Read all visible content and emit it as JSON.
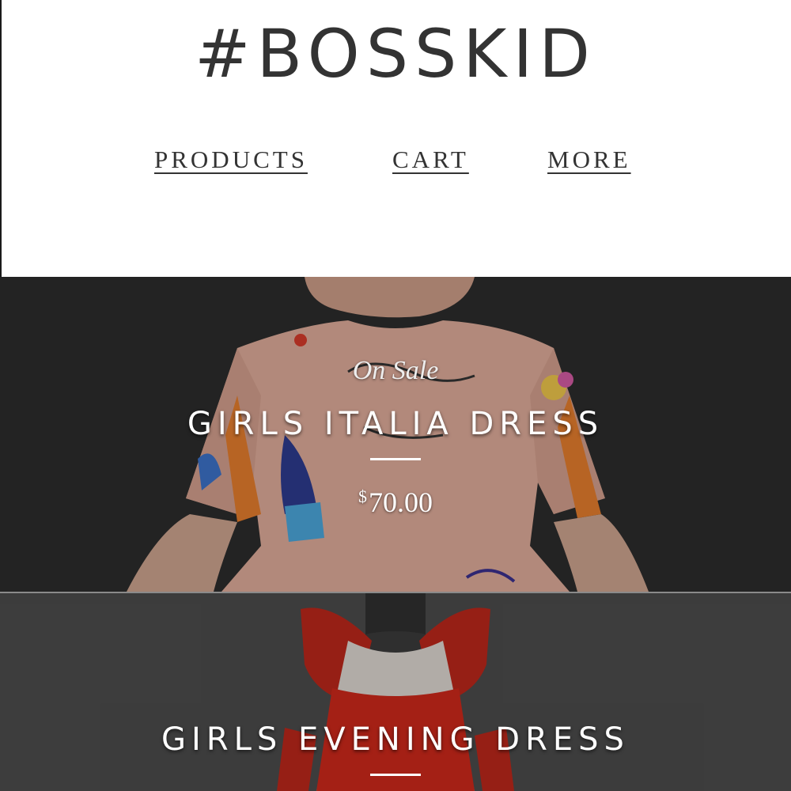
{
  "header": {
    "brand": "#BOSSKID"
  },
  "nav": {
    "products": "PRODUCTS",
    "cart": "CART",
    "more": "MORE"
  },
  "products": [
    {
      "badge": "On Sale",
      "title": "GIRLS ITALIA DRESS",
      "currency": "$",
      "price": "70.00"
    },
    {
      "title": "GIRLS EVENING DRESS"
    }
  ],
  "colors": {
    "text_dark": "#333333",
    "tile1_bg": "#2b2b2b",
    "tile2_bg": "#4a4a4a",
    "dress1": "#e8a896",
    "dress2": "#c8281a"
  }
}
